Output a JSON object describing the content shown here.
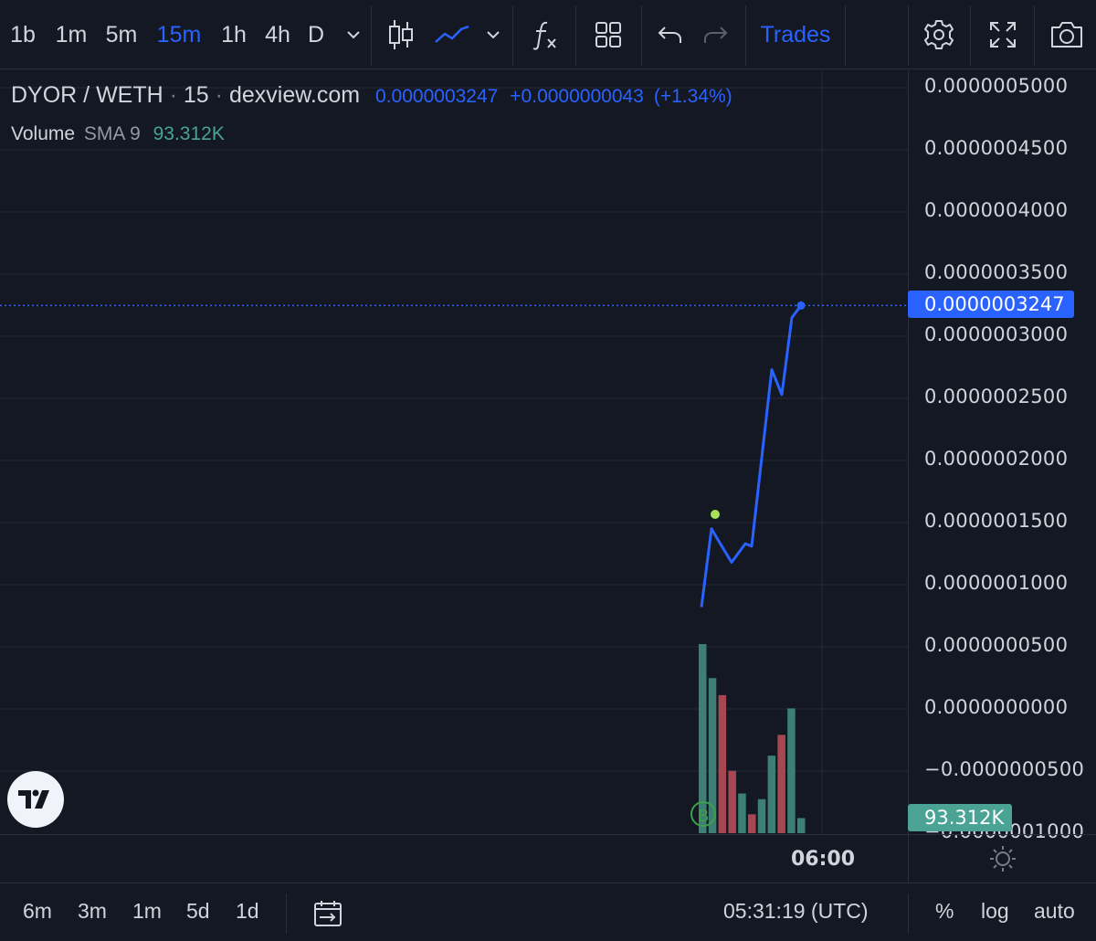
{
  "toolbar": {
    "intervals": [
      "1b",
      "1m",
      "5m",
      "15m",
      "1h",
      "4h",
      "D"
    ],
    "active_interval": "15m",
    "trades_label": "Trades"
  },
  "legend": {
    "pair": "DYOR / WETH",
    "interval": "15",
    "source": "dexview.com",
    "price": "0.0000003247",
    "change": "+0.0000000043",
    "change_pct": "(+1.34%)",
    "volume_label": "Volume",
    "volume_sma": "SMA 9",
    "volume_value": "93.312K"
  },
  "price_tag": "0.0000003247",
  "volume_tag": "93.312K",
  "time_axis_label": "06:00",
  "bottom": {
    "ranges": [
      "6m",
      "3m",
      "1m",
      "5d",
      "1d"
    ],
    "clock": "05:31:19 (UTC)",
    "percent": "%",
    "log": "log",
    "auto": "auto"
  },
  "colors": {
    "background": "#141823",
    "line": "#2962ff",
    "up": "#4aa394",
    "down": "#e05561",
    "grid": "#262a36",
    "marker": "#a6e35a"
  },
  "chart_data": {
    "type": "line",
    "title": "DYOR / WETH",
    "ylim": [
      -1e-07,
      5e-07
    ],
    "y_ticks": [
      "0.0000005000",
      "0.0000004500",
      "0.0000004000",
      "0.0000003500",
      "0.0000003000",
      "0.0000002500",
      "0.0000002000",
      "0.0000001500",
      "0.0000001000",
      "0.0000000500",
      "0.0000000000",
      "−0.0000000500",
      "−0.0000001000"
    ],
    "y_tick_values": [
      5e-07,
      4.5e-07,
      4e-07,
      3.5e-07,
      3e-07,
      2.5e-07,
      2e-07,
      1.5e-07,
      1e-07,
      5e-08,
      0,
      -5e-08,
      -1e-07
    ],
    "x_tick_labels": [
      "06:00"
    ],
    "series": [
      {
        "values": [
          8.2e-08,
          1.45e-07,
          1.35e-07,
          1.18e-07,
          1.33e-07,
          1.31e-07,
          2.73e-07,
          2.53e-07,
          3.15e-07,
          3.247e-07
        ]
      }
    ],
    "volume": {
      "values": [
        100,
        82,
        73,
        33,
        21,
        10,
        18,
        41,
        52,
        66,
        8
      ],
      "directions": [
        "up",
        "up",
        "down",
        "down",
        "up",
        "down",
        "up",
        "up",
        "down",
        "up",
        "up"
      ],
      "sma9": "93.312K"
    }
  }
}
